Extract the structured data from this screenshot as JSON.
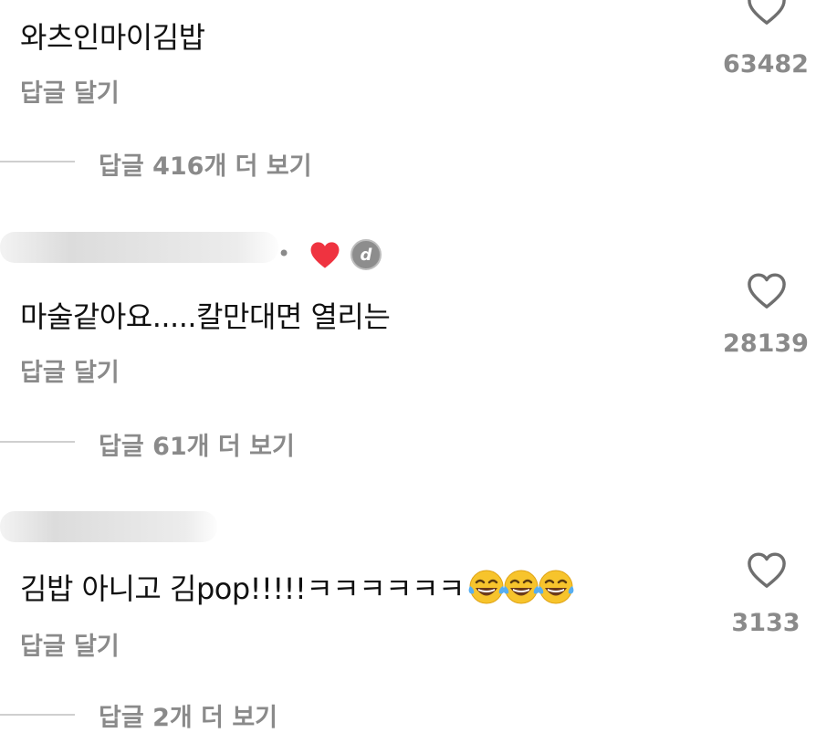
{
  "comments": [
    {
      "text": "와츠인마이김밥",
      "reply_label": "답글 달기",
      "likes": "63482",
      "view_replies": "답글 416개 더 보기"
    },
    {
      "text": "마술같아요.....칼만대면 열리는",
      "reply_label": "답글 달기",
      "likes": "28139",
      "view_replies": "답글 61개 더 보기",
      "creator_liked": true,
      "creator_avatar_letter": "d"
    },
    {
      "text": "김밥 아니고 김pop!!!!!ㅋㅋㅋㅋㅋㅋ",
      "emoji": [
        "face-with-tears-of-joy",
        "face-with-tears-of-joy",
        "face-with-tears-of-joy"
      ],
      "reply_label": "답글 달기",
      "likes": "3133",
      "view_replies": "답글 2개 더 보기"
    }
  ],
  "colors": {
    "heart_red": "#ef3340",
    "muted": "#8a8a8a",
    "text": "#111111"
  },
  "icons": {
    "like": "heart-outline-icon",
    "creator_like": "heart-filled-icon",
    "separator": "dot-separator"
  }
}
